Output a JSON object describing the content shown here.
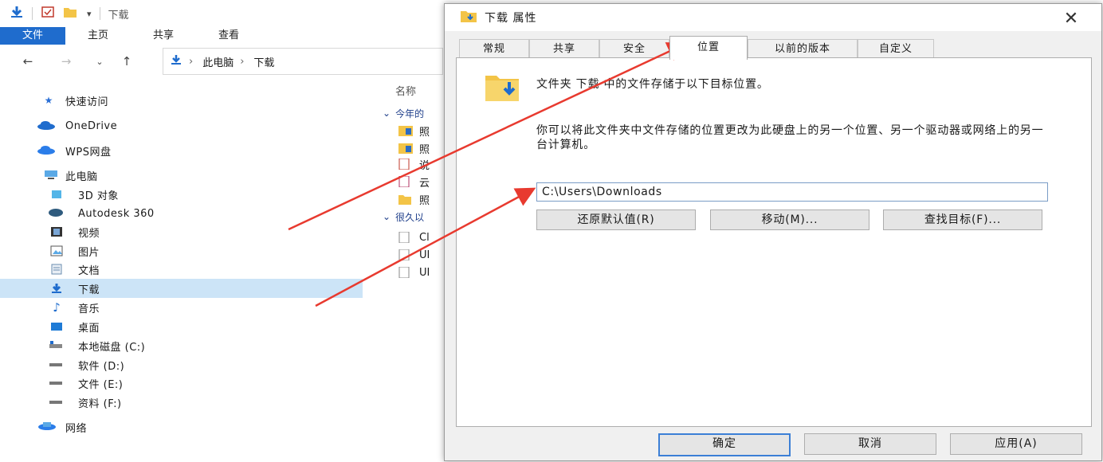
{
  "explorer": {
    "title": "下载",
    "ribbon_tabs": [
      "文件",
      "主页",
      "共享",
      "查看"
    ],
    "breadcrumb": [
      "此电脑",
      "下载"
    ],
    "sidebar": [
      {
        "label": "快速访问",
        "icon": "star-icon"
      },
      {
        "label": "OneDrive",
        "icon": "cloud-icon"
      },
      {
        "label": "WPS网盘",
        "icon": "cloud-icon"
      },
      {
        "label": "此电脑",
        "icon": "computer-icon"
      },
      {
        "label": "3D 对象",
        "icon": "cube-icon"
      },
      {
        "label": "Autodesk 360",
        "icon": "autodesk-icon"
      },
      {
        "label": "视频",
        "icon": "video-icon"
      },
      {
        "label": "图片",
        "icon": "picture-icon"
      },
      {
        "label": "文档",
        "icon": "document-icon"
      },
      {
        "label": "下载",
        "icon": "download-icon",
        "selected": true
      },
      {
        "label": "音乐",
        "icon": "music-icon"
      },
      {
        "label": "桌面",
        "icon": "desktop-icon"
      },
      {
        "label": "本地磁盘 (C:)",
        "icon": "drive-icon"
      },
      {
        "label": "软件 (D:)",
        "icon": "drive-icon"
      },
      {
        "label": "文件 (E:)",
        "icon": "drive-icon"
      },
      {
        "label": "资料 (F:)",
        "icon": "drive-icon"
      },
      {
        "label": "网络",
        "icon": "network-icon"
      }
    ],
    "filelist": {
      "header": "名称",
      "group1": "今年的",
      "group2": "很久以",
      "rows": [
        "照",
        "照",
        "说",
        "云",
        "照",
        "Cl",
        "UI",
        "UI"
      ]
    }
  },
  "dialog": {
    "title": "下载 属性",
    "tabs": [
      "常规",
      "共享",
      "安全",
      "位置",
      "以前的版本",
      "自定义"
    ],
    "active_tab": "位置",
    "line1": "文件夹 下载 中的文件存储于以下目标位置。",
    "line2": "你可以将此文件夹中文件存储的位置更改为此硬盘上的另一个位置、另一个驱动器或网络上的另一台计算机。",
    "path": "C:\\Users\\Downloads",
    "buttons": {
      "restore": "还原默认值(R)",
      "move": "移动(M)...",
      "find": "查找目标(F)..."
    },
    "footer": {
      "ok": "确定",
      "cancel": "取消",
      "apply": "应用(A)"
    }
  },
  "colors": {
    "accent": "#1f6ccd",
    "selected": "#cce4f7",
    "arrow": "#e83a2f"
  }
}
